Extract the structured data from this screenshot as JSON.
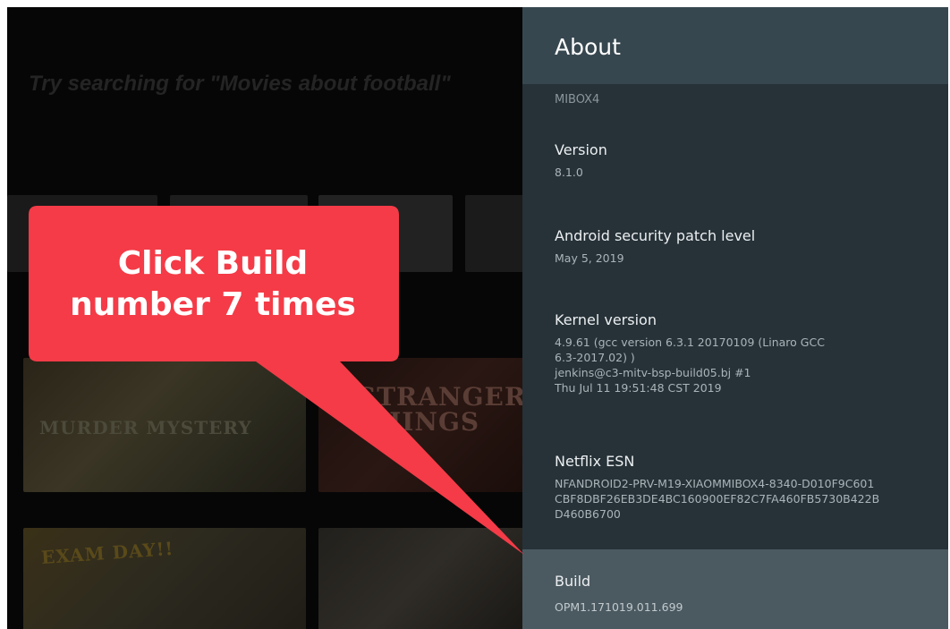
{
  "background": {
    "search_hint": "Try searching for \"Movies about football\"",
    "cards": [
      {
        "title": "MURDER MYSTERY"
      },
      {
        "title": "STRANGER THINGS"
      },
      {
        "title": "EXAM DAY!!"
      }
    ]
  },
  "callout": {
    "text_line1": "Click Build",
    "text_line2": "number 7 times",
    "color": "#f43b47"
  },
  "about": {
    "title": "About",
    "partial_item_value": "MIBOX4",
    "items": [
      {
        "label": "Version",
        "value": [
          "8.1.0"
        ]
      },
      {
        "label": "Android security patch level",
        "value": [
          "May 5, 2019"
        ]
      },
      {
        "label": "Kernel version",
        "value": [
          "4.9.61 (gcc version 6.3.1 20170109 (Linaro GCC",
          "6.3-2017.02) )",
          "jenkins@c3-mitv-bsp-build05.bj #1",
          "Thu Jul 11 19:51:48 CST 2019"
        ]
      },
      {
        "label": "Netflix ESN",
        "value": [
          "NFANDROID2-PRV-M19-XIAOMMIBOX4-8340-D010F9C601",
          "CBF8DBF26EB3DE4BC160900EF82C7FA460FB5730B422B",
          "D460B6700"
        ]
      }
    ],
    "build": {
      "label": "Build",
      "value": "OPM1.171019.011.699"
    }
  }
}
